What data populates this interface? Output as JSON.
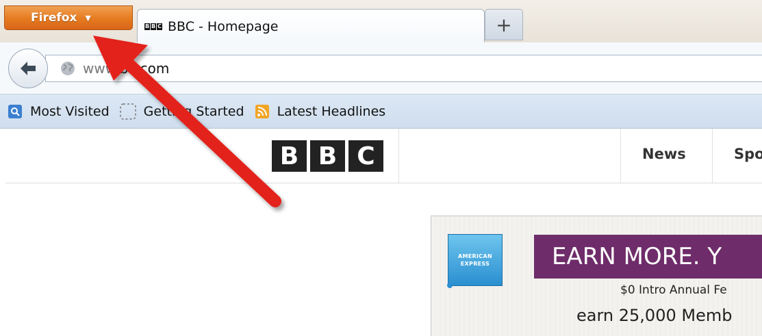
{
  "browser": {
    "menu_button_label": "Firefox",
    "tabs": [
      {
        "title": "BBC - Homepage",
        "favicon_letters": [
          "B",
          "B",
          "C"
        ]
      }
    ],
    "new_tab_label": "+"
  },
  "navbar": {
    "url_faded": "www.",
    "url_main": "bc.com"
  },
  "bookmarks": [
    {
      "label": "Most Visited",
      "icon": "most-visited-icon"
    },
    {
      "label": "Getting Started",
      "icon": "getting-started-icon"
    },
    {
      "label": "Latest Headlines",
      "icon": "rss-feed-icon"
    }
  ],
  "page": {
    "logo_letters": [
      "B",
      "B",
      "C"
    ],
    "nav": [
      {
        "label": "News"
      },
      {
        "label": "Spo"
      }
    ],
    "ad": {
      "brand_line1": "AMERICAN",
      "brand_line2": "EXPRESS",
      "headline": "EARN MORE. Y",
      "line1": "$0 Intro Annual Fe",
      "line2": "earn 25,000 Memb"
    }
  },
  "colors": {
    "firefox_orange": "#e57a1f",
    "annotation_arrow": "#e3231b",
    "ad_banner": "#6e2c6a",
    "amex_blue": "#2a8fd0"
  }
}
